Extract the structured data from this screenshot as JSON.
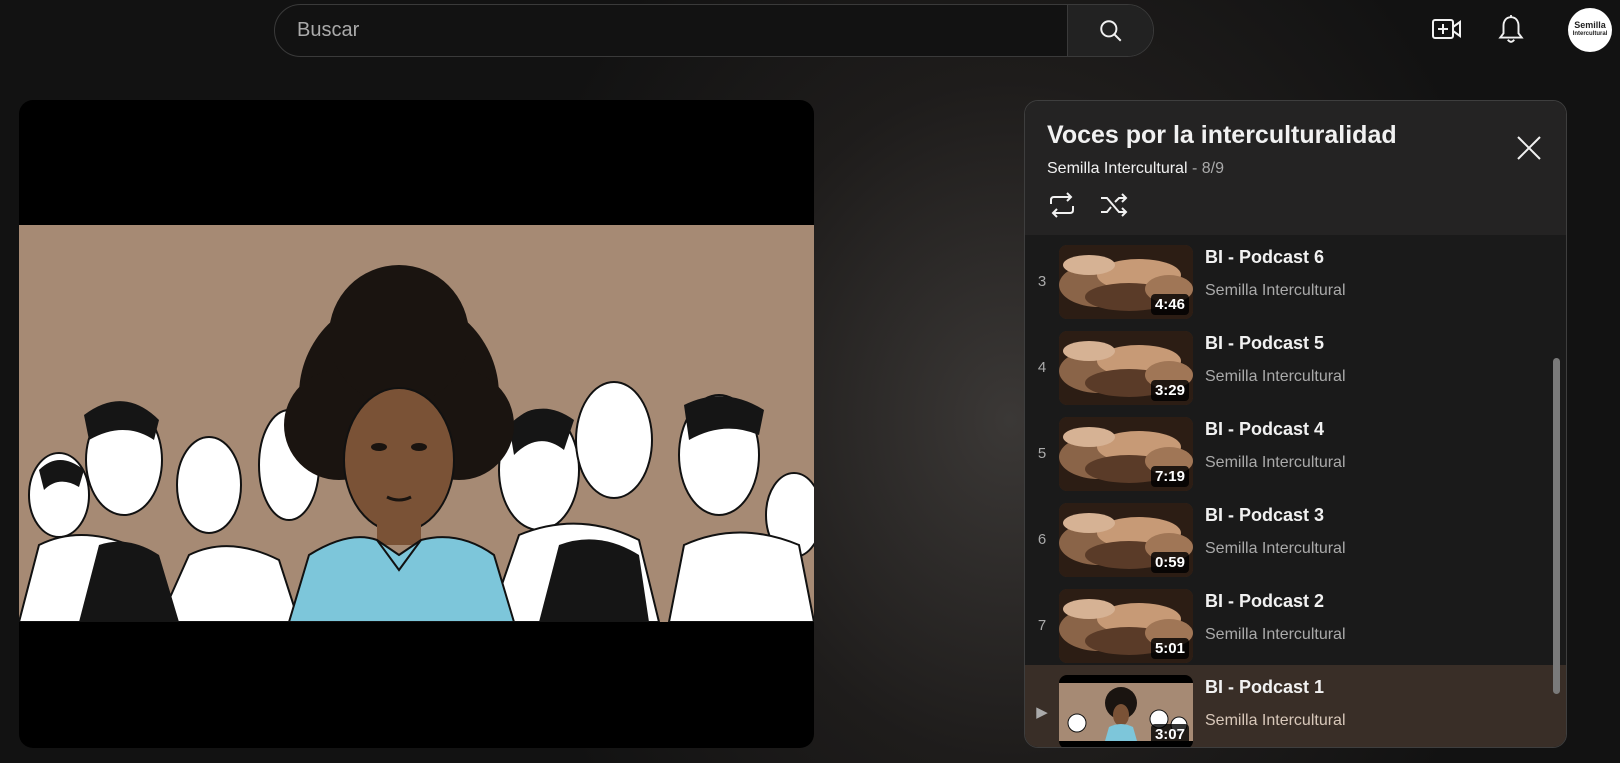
{
  "search": {
    "placeholder": "Buscar"
  },
  "icons": {
    "search": "search-icon",
    "create": "create-video-icon",
    "notifications": "bell-icon",
    "avatar": "avatar"
  },
  "avatar": {
    "line1": "Semilla",
    "line2": "Intercultural"
  },
  "playlist": {
    "title": "Voces por la interculturalidad",
    "channel": "Semilla Intercultural",
    "position": "- 8/9",
    "items": [
      {
        "index": "3",
        "title": "BI - Podcast 6",
        "channel": "Semilla Intercultural",
        "duration": "4:46"
      },
      {
        "index": "4",
        "title": "BI - Podcast 5",
        "channel": "Semilla Intercultural",
        "duration": "3:29"
      },
      {
        "index": "5",
        "title": "BI - Podcast 4",
        "channel": "Semilla Intercultural",
        "duration": "7:19"
      },
      {
        "index": "6",
        "title": "BI - Podcast 3",
        "channel": "Semilla Intercultural",
        "duration": "0:59"
      },
      {
        "index": "7",
        "title": "BI - Podcast 2",
        "channel": "Semilla Intercultural",
        "duration": "5:01"
      },
      {
        "index": "▶",
        "title": "BI - Podcast 1",
        "channel": "Semilla Intercultural",
        "duration": "3:07"
      }
    ]
  },
  "colors": {
    "background": "#121212",
    "active_item": "#392e27",
    "video_bg": "#a68a74"
  }
}
